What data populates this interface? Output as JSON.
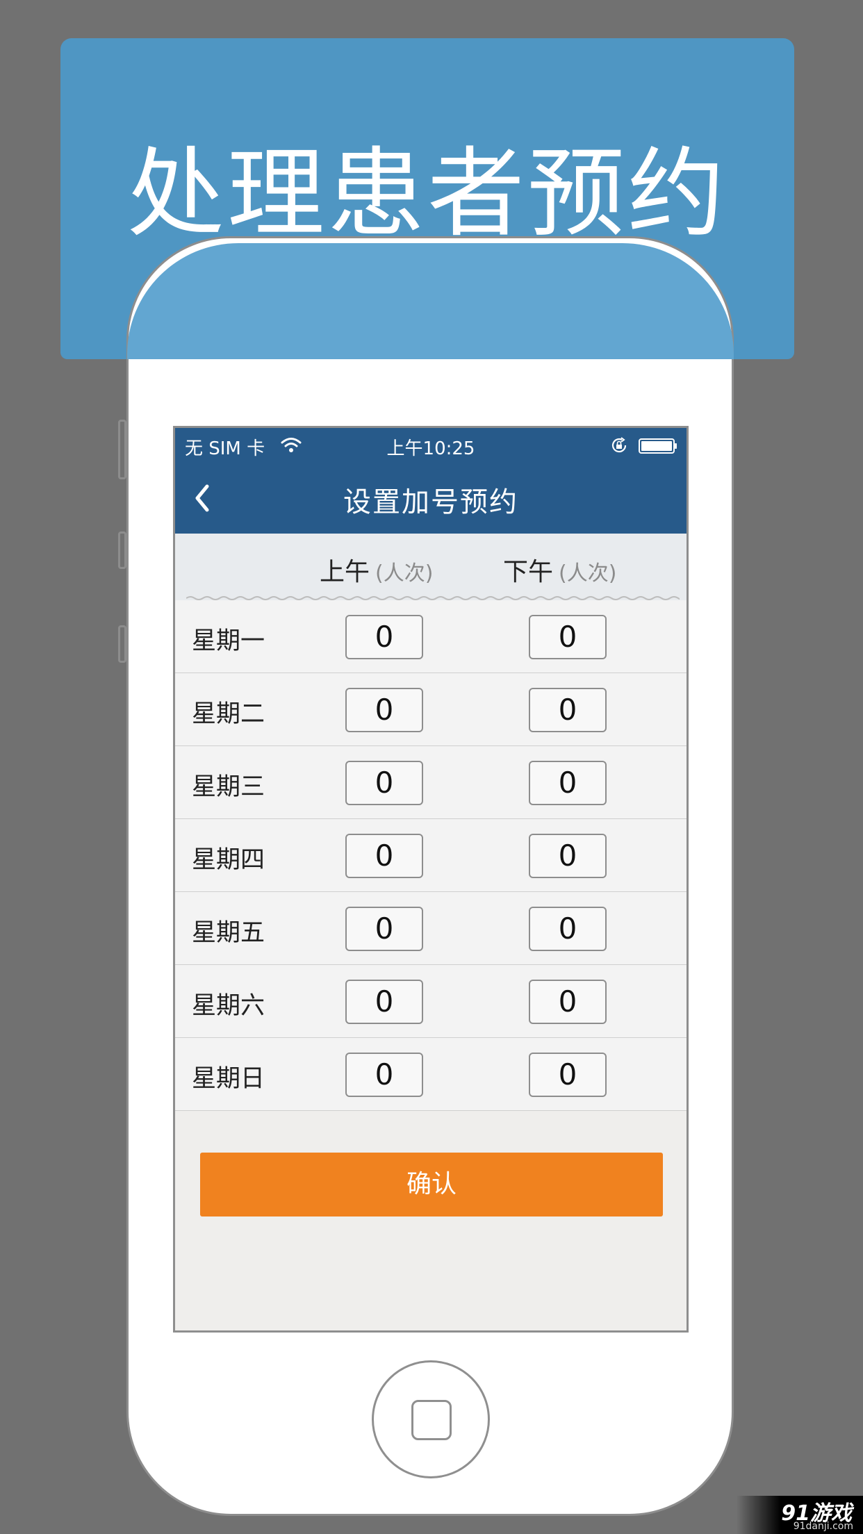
{
  "banner": {
    "title": "处理患者预约"
  },
  "status_bar": {
    "carrier": "无 SIM 卡",
    "time": "上午10:25",
    "wifi_icon": "wifi-icon",
    "lock_icon": "rotation-lock-icon",
    "battery_icon": "battery-icon"
  },
  "nav": {
    "title": "设置加号预约",
    "back_icon": "chevron-left-icon"
  },
  "columns": {
    "am": {
      "label": "上午",
      "unit": "(人次)"
    },
    "pm": {
      "label": "下午",
      "unit": "(人次)"
    }
  },
  "rows": [
    {
      "day": "星期一",
      "am": "0",
      "pm": "0"
    },
    {
      "day": "星期二",
      "am": "0",
      "pm": "0"
    },
    {
      "day": "星期三",
      "am": "0",
      "pm": "0"
    },
    {
      "day": "星期四",
      "am": "0",
      "pm": "0"
    },
    {
      "day": "星期五",
      "am": "0",
      "pm": "0"
    },
    {
      "day": "星期六",
      "am": "0",
      "pm": "0"
    },
    {
      "day": "星期日",
      "am": "0",
      "pm": "0"
    }
  ],
  "confirm_label": "确认",
  "watermark": {
    "brand": "91游戏",
    "url": "91danji.com"
  },
  "colors": {
    "background": "#717171",
    "banner": "#4f96c3",
    "navbar": "#275a8a",
    "confirm": "#f0821f"
  }
}
